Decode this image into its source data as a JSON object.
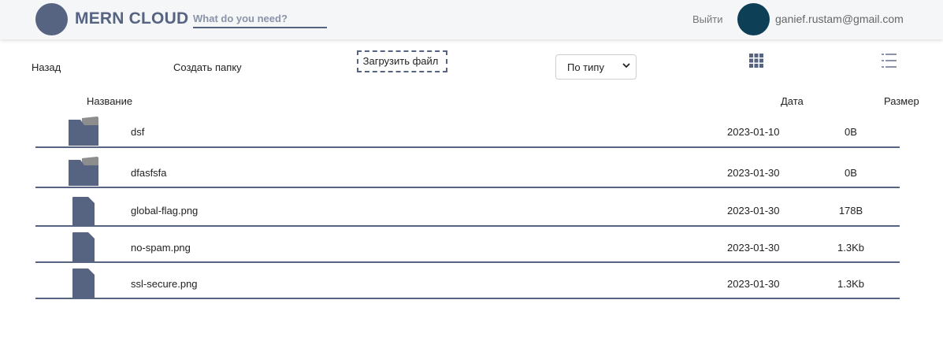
{
  "navbar": {
    "brand": "MERN CLOUD",
    "search_placeholder": "What do you need?",
    "logout_label": "Выйти",
    "user_email": "ganief.rustam@gmail.com"
  },
  "toolbar": {
    "back_label": "Назад",
    "create_folder_label": "Создать папку",
    "upload_label": "Загрузить файл",
    "sort_selected": "По типу",
    "view_plate_icon": "grid-icon",
    "view_list_icon": "list-icon"
  },
  "table": {
    "headers": {
      "name": "Название",
      "date": "Дата",
      "size": "Размер"
    },
    "rows": [
      {
        "type": "folder",
        "icon": "folder-icon",
        "name": "dsf",
        "date": "2023-01-10",
        "size": "0B"
      },
      {
        "type": "folder",
        "icon": "folder-icon",
        "name": "dfasfsfa",
        "date": "2023-01-30",
        "size": "0B"
      },
      {
        "type": "file",
        "icon": "file-icon",
        "name": "global-flag.png",
        "date": "2023-01-30",
        "size": "178B"
      },
      {
        "type": "file",
        "icon": "file-icon",
        "name": "no-spam.png",
        "date": "2023-01-30",
        "size": "1.3Kb"
      },
      {
        "type": "file",
        "icon": "file-icon",
        "name": "ssl-secure.png",
        "date": "2023-01-30",
        "size": "1.3Kb"
      }
    ]
  },
  "colors": {
    "accent": "#566381",
    "avatar": "#0d3f56",
    "folder_tab": "#8d8d8d",
    "navbar_bg": "#f5f6f8"
  }
}
